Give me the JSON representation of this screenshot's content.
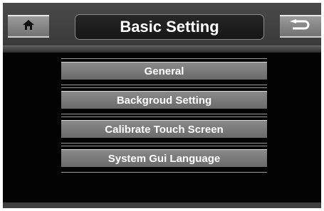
{
  "header": {
    "title": "Basic Setting",
    "home_icon": "home-icon",
    "back_icon": "back-arrow-icon"
  },
  "menu": {
    "items": [
      {
        "label": "General"
      },
      {
        "label": "Backgroud Setting"
      },
      {
        "label": "Calibrate Touch Screen"
      },
      {
        "label": "System Gui Language"
      }
    ]
  },
  "colors": {
    "background": "#030303",
    "bar": "#7a7a7a",
    "text": "#ffffff"
  }
}
